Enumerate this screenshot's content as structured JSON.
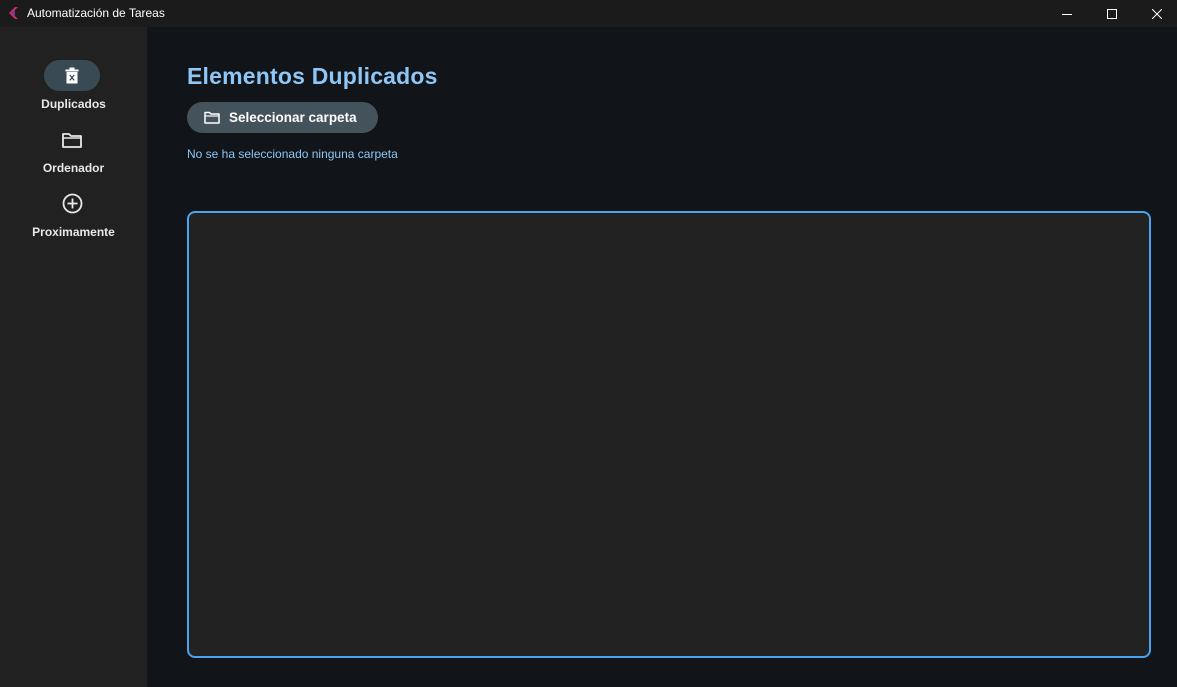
{
  "window": {
    "title": "Automatización de Tareas"
  },
  "sidebar": {
    "items": [
      {
        "label": "Duplicados",
        "icon": "trash-icon",
        "active": true
      },
      {
        "label": "Ordenador",
        "icon": "folder-icon",
        "active": false
      },
      {
        "label": "Proximamente",
        "icon": "plus-circle-icon",
        "active": false
      }
    ]
  },
  "main": {
    "title": "Elementos Duplicados",
    "select_button_label": "Seleccionar carpeta",
    "status": "No se ha seleccionado ninguna carpeta"
  },
  "colors": {
    "accent": "#8ec6f5",
    "border": "#4aa3ee",
    "sidebar_bg": "#212121",
    "main_bg": "#111418",
    "active_pill": "#3a4a55",
    "button_bg": "#44525b"
  }
}
